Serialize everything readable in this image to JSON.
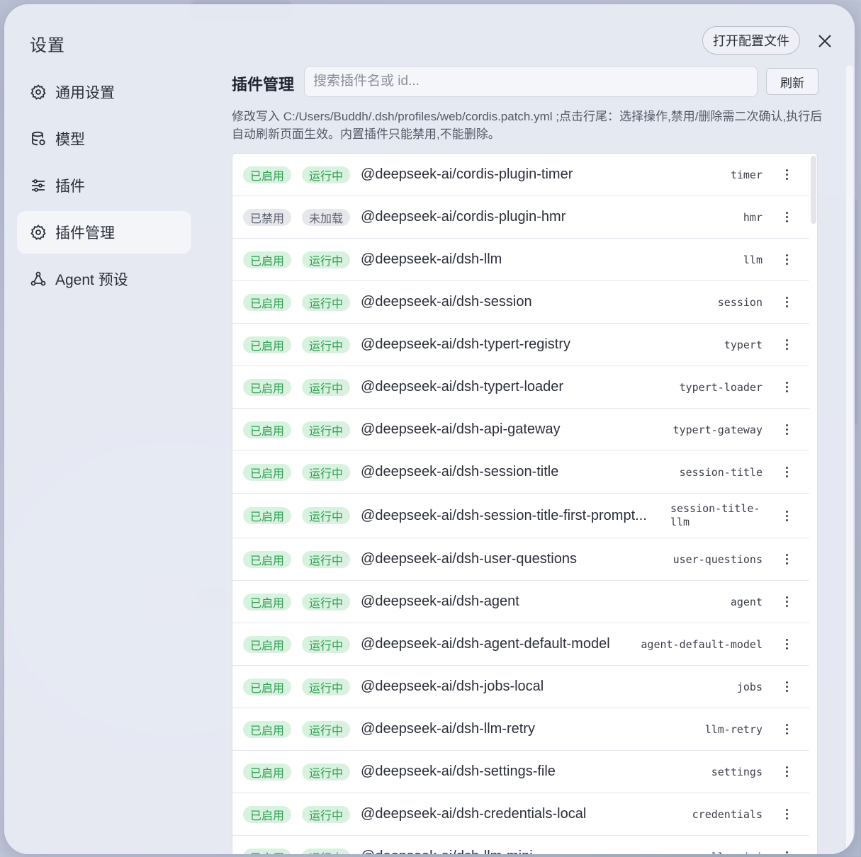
{
  "settings_title": "设置",
  "nav": [
    {
      "label": "通用设置",
      "icon": "gear-icon",
      "active": false
    },
    {
      "label": "模型",
      "icon": "database-icon",
      "active": false
    },
    {
      "label": "插件",
      "icon": "sliders-icon",
      "active": false
    },
    {
      "label": "插件管理",
      "icon": "gear-icon",
      "active": true
    },
    {
      "label": "Agent 预设",
      "icon": "agent-network-icon",
      "active": false
    }
  ],
  "header": {
    "open_config_label": "打开配置文件",
    "close_icon": "close-icon"
  },
  "plugin_manager": {
    "title": "插件管理",
    "search_placeholder": "搜索插件名或 id...",
    "refresh_label": "刷新",
    "description": "修改写入 C:/Users/Buddh/.dsh/profiles/web/cordis.patch.yml ;点击行尾：选择操作,禁用/删除需二次确认,执行后自动刷新页面生效。内置插件只能禁用,不能删除。"
  },
  "colors": {
    "enabled_badge_bg": "#d8f2df",
    "enabled_badge_text": "#2f9e52",
    "disabled_badge_bg": "#e7e8ec",
    "disabled_badge_text": "#5c6070"
  },
  "plugins": [
    {
      "status": "已启用",
      "state": "运行中",
      "name": "@deepseek-ai/cordis-plugin-timer",
      "id": "timer"
    },
    {
      "status": "已禁用",
      "state": "未加载",
      "name": "@deepseek-ai/cordis-plugin-hmr",
      "id": "hmr"
    },
    {
      "status": "已启用",
      "state": "运行中",
      "name": "@deepseek-ai/dsh-llm",
      "id": "llm"
    },
    {
      "status": "已启用",
      "state": "运行中",
      "name": "@deepseek-ai/dsh-session",
      "id": "session"
    },
    {
      "status": "已启用",
      "state": "运行中",
      "name": "@deepseek-ai/dsh-typert-registry",
      "id": "typert"
    },
    {
      "status": "已启用",
      "state": "运行中",
      "name": "@deepseek-ai/dsh-typert-loader",
      "id": "typert-loader"
    },
    {
      "status": "已启用",
      "state": "运行中",
      "name": "@deepseek-ai/dsh-api-gateway",
      "id": "typert-gateway"
    },
    {
      "status": "已启用",
      "state": "运行中",
      "name": "@deepseek-ai/dsh-session-title",
      "id": "session-title"
    },
    {
      "status": "已启用",
      "state": "运行中",
      "name": "@deepseek-ai/dsh-session-title-first-prompt...",
      "id": "session-title-llm"
    },
    {
      "status": "已启用",
      "state": "运行中",
      "name": "@deepseek-ai/dsh-user-questions",
      "id": "user-questions"
    },
    {
      "status": "已启用",
      "state": "运行中",
      "name": "@deepseek-ai/dsh-agent",
      "id": "agent"
    },
    {
      "status": "已启用",
      "state": "运行中",
      "name": "@deepseek-ai/dsh-agent-default-model",
      "id": "agent-default-model"
    },
    {
      "status": "已启用",
      "state": "运行中",
      "name": "@deepseek-ai/dsh-jobs-local",
      "id": "jobs"
    },
    {
      "status": "已启用",
      "state": "运行中",
      "name": "@deepseek-ai/dsh-llm-retry",
      "id": "llm-retry"
    },
    {
      "status": "已启用",
      "state": "运行中",
      "name": "@deepseek-ai/dsh-settings-file",
      "id": "settings"
    },
    {
      "status": "已启用",
      "state": "运行中",
      "name": "@deepseek-ai/dsh-credentials-local",
      "id": "credentials"
    },
    {
      "status": "已启用",
      "state": "运行中",
      "name": "@deepseek-ai/dsh-llm-mini",
      "id": "llm-mini"
    }
  ]
}
